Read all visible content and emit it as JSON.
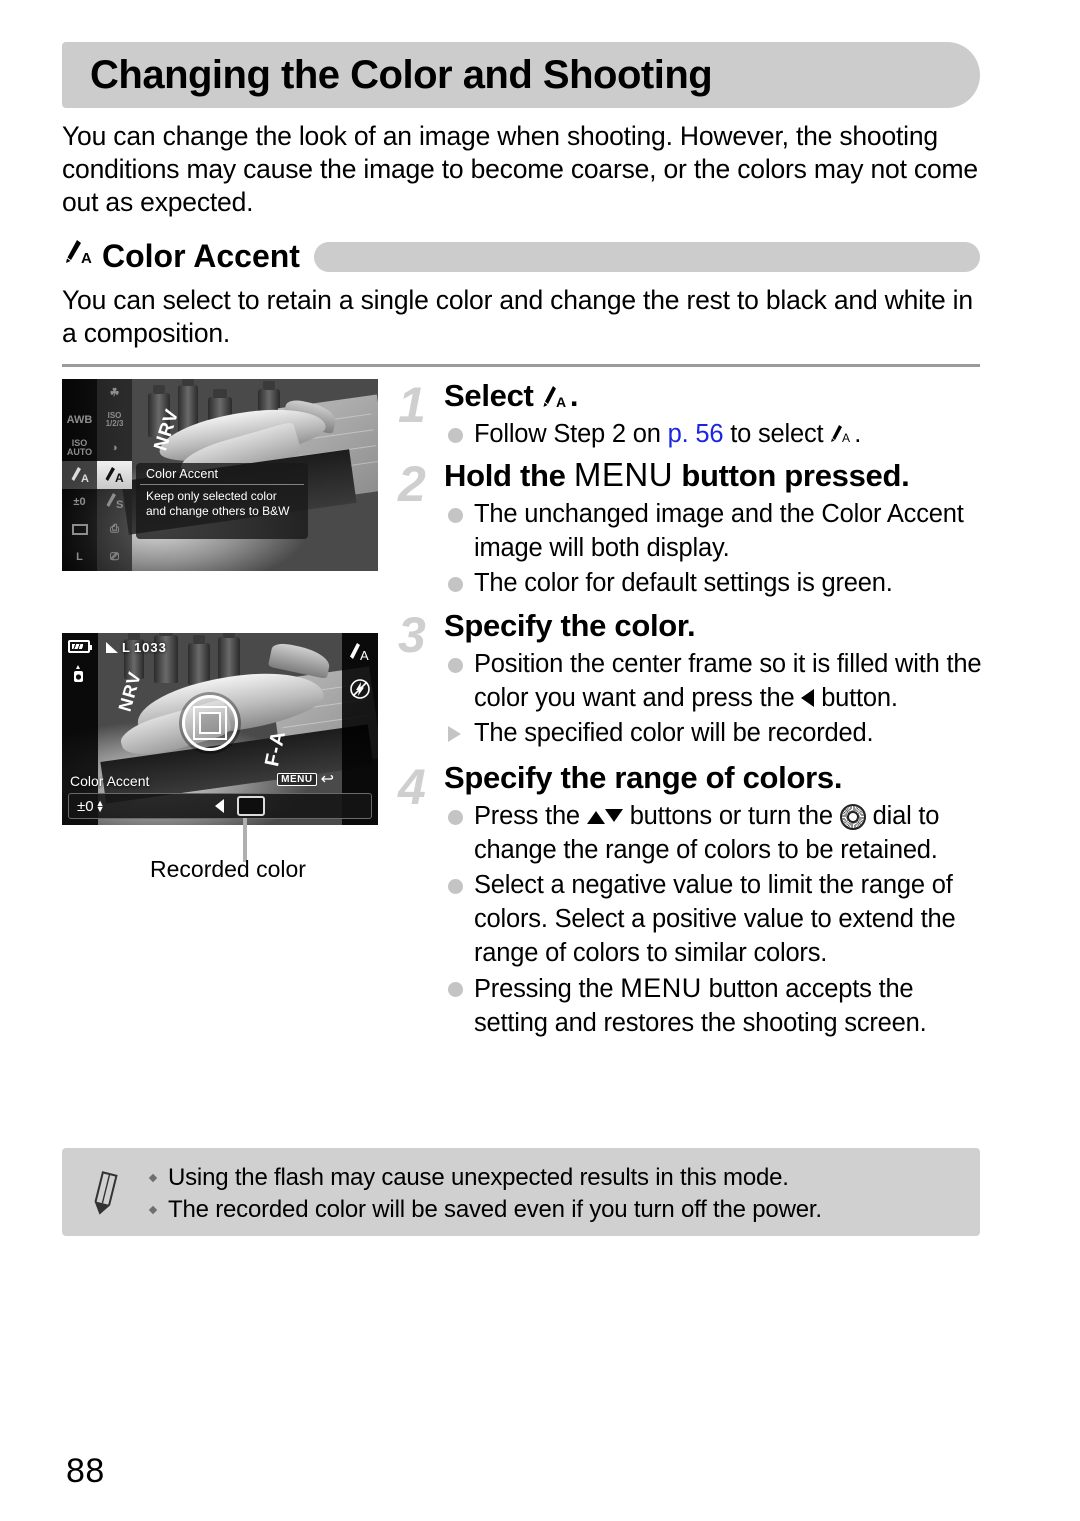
{
  "page": {
    "number": "88",
    "title": "Changing the Color and Shooting",
    "intro": "You can change the look of an image when shooting. However, the shooting conditions may cause the image to become coarse, or the colors may not come out as expected."
  },
  "section": {
    "icon": "color-accent-icon",
    "title": "Color Accent",
    "description": "You can select to retain a single color and change the rest to black and white in a composition."
  },
  "figures": {
    "shot1": {
      "menu_title": "Color Accent",
      "menu_desc_line1": "Keep only selected color",
      "menu_desc_line2": "and change others to B&W",
      "rail_left": [
        "AWB",
        "ISO AUTO",
        "color-accent-icon",
        "±0",
        "frame-icon",
        "L"
      ],
      "rail_right": [
        "macro-icon",
        "ISO 1/2/3",
        "red-eye-icon",
        "color-accent-icon",
        "color-swap-icon",
        "print-icon",
        "drive-icon"
      ]
    },
    "shot2": {
      "battery": "battery-icon",
      "flash_status": "flash-off-icon",
      "quality": "L",
      "shots_remaining": "1033",
      "mode_label": "Color Accent",
      "menu_chip": "MENU",
      "menu_chip_action": "back-arrow-icon",
      "adjust_value": "±0",
      "left_button": "left-arrow-icon",
      "recorded_swatch": "recorded-color-swatch",
      "right_icons": [
        "color-accent-icon",
        "flash-off-icon"
      ]
    },
    "caption": "Recorded color"
  },
  "steps": [
    {
      "num": "1",
      "heading_pre": "Select ",
      "heading_icon": "color-accent-icon",
      "heading_post": ".",
      "bullets": [
        {
          "type": "dot",
          "parts": [
            {
              "t": "text",
              "v": "Follow Step 2 on "
            },
            {
              "t": "link",
              "v": "p. 56"
            },
            {
              "t": "text",
              "v": " to select "
            },
            {
              "t": "icon",
              "v": "color-accent-icon"
            },
            {
              "t": "text",
              "v": "."
            }
          ]
        }
      ]
    },
    {
      "num": "2",
      "heading_pre": "Hold the ",
      "heading_icon": "MENU",
      "heading_post": " button pressed.",
      "bullets": [
        {
          "type": "dot",
          "parts": [
            {
              "t": "text",
              "v": "The unchanged image and the Color Accent image will both display."
            }
          ]
        },
        {
          "type": "dot",
          "parts": [
            {
              "t": "text",
              "v": "The color for default settings is green."
            }
          ]
        }
      ]
    },
    {
      "num": "3",
      "heading_pre": "Specify the color.",
      "heading_icon": "",
      "heading_post": "",
      "bullets": [
        {
          "type": "dot",
          "parts": [
            {
              "t": "text",
              "v": "Position the center frame so it is filled with the color you want and press the "
            },
            {
              "t": "icon",
              "v": "left-arrow-icon"
            },
            {
              "t": "text",
              "v": " button."
            }
          ]
        },
        {
          "type": "tri",
          "parts": [
            {
              "t": "text",
              "v": "The specified color will be recorded."
            }
          ]
        }
      ]
    },
    {
      "num": "4",
      "heading_pre": "Specify the range of colors.",
      "heading_icon": "",
      "heading_post": "",
      "bullets": [
        {
          "type": "dot",
          "parts": [
            {
              "t": "text",
              "v": "Press the "
            },
            {
              "t": "icon",
              "v": "up-arrow-icon"
            },
            {
              "t": "icon",
              "v": "down-arrow-icon"
            },
            {
              "t": "text",
              "v": " buttons or turn the "
            },
            {
              "t": "icon",
              "v": "control-dial-icon"
            },
            {
              "t": "text",
              "v": " dial to change the range of colors to be retained."
            }
          ]
        },
        {
          "type": "dot",
          "parts": [
            {
              "t": "text",
              "v": "Select a negative value to limit the range of colors. Select a positive value to extend the range of colors to similar colors."
            }
          ]
        },
        {
          "type": "dot",
          "parts": [
            {
              "t": "text",
              "v": "Pressing the "
            },
            {
              "t": "icon",
              "v": "MENU"
            },
            {
              "t": "text",
              "v": " button accepts the setting and restores the shooting screen."
            }
          ]
        }
      ]
    }
  ],
  "note": {
    "icon": "pencil-note-icon",
    "items": [
      "Using the flash may cause unexpected results in this mode.",
      "The recorded color will be saved even if you turn off the power."
    ]
  },
  "colors": {
    "header_gray": "#cccccc",
    "note_gray": "#d0d0d0",
    "step_number_gray": "#cfcfcf",
    "bullet_gray": "#c4c4c4",
    "link_blue": "#1a27e0",
    "rule_gray": "#9a9a9a"
  }
}
